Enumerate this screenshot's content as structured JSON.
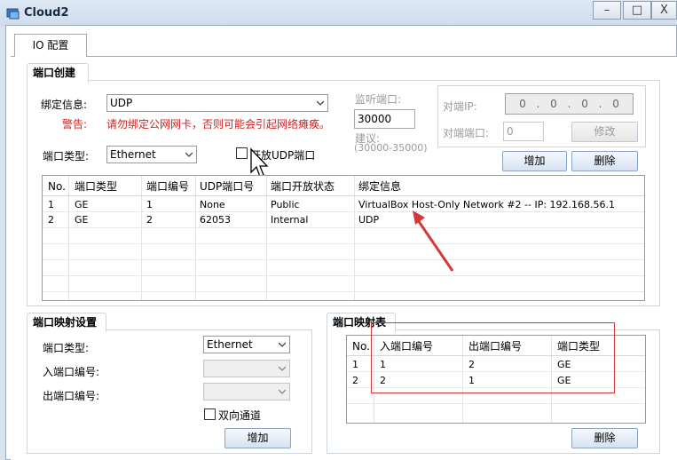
{
  "window": {
    "title": "Cloud2",
    "minimize": "–",
    "maximize": "□",
    "close": "X"
  },
  "tab": {
    "label": "IO 配置"
  },
  "port_create": {
    "title": "端口创建",
    "binding_label": "绑定信息:",
    "binding_value": "UDP",
    "warning_label": "警告:",
    "warning_text": "请勿绑定公网网卡，否则可能会引起网络瘫痪。",
    "port_type_label": "端口类型:",
    "port_type_value": "Ethernet",
    "open_udp_label": "开放UDP端口",
    "listen_port_label": "监听端口:",
    "listen_port_value": "30000",
    "suggest_label": "建议:",
    "suggest_range": "(30000-35000)",
    "peer_ip_label": "对端IP:",
    "peer_ip_value": "0 . 0 . 0 . 0",
    "peer_port_label": "对端端口:",
    "peer_port_value": "0",
    "modify_button": "修改",
    "add_button": "增加",
    "delete_button": "删除",
    "table": {
      "headers": [
        "No.",
        "端口类型",
        "端口编号",
        "UDP端口号",
        "端口开放状态",
        "绑定信息"
      ],
      "rows": [
        [
          "1",
          "GE",
          "1",
          "None",
          "Public",
          "VirtualBox Host-Only Network #2 -- IP: 192.168.56.1"
        ],
        [
          "2",
          "GE",
          "2",
          "62053",
          "Internal",
          "UDP"
        ]
      ]
    }
  },
  "port_mapping_settings": {
    "title": "端口映射设置",
    "port_type_label": "端口类型:",
    "port_type_value": "Ethernet",
    "in_port_label": "入端口编号:",
    "in_port_value": "",
    "out_port_label": "出端口编号:",
    "out_port_value": "",
    "bidirectional_label": "双向通道",
    "add_button": "增加"
  },
  "port_mapping_table": {
    "title": "端口映射表",
    "headers": [
      "No.",
      "入端口编号",
      "出端口编号",
      "端口类型"
    ],
    "rows": [
      [
        "1",
        "1",
        "2",
        "GE"
      ],
      [
        "2",
        "2",
        "1",
        "GE"
      ]
    ],
    "delete_button": "删除"
  },
  "colors": {
    "window_frame": "#d9e3ee",
    "warning_red": "#d42020",
    "annotation_red": "#d23a3a"
  }
}
